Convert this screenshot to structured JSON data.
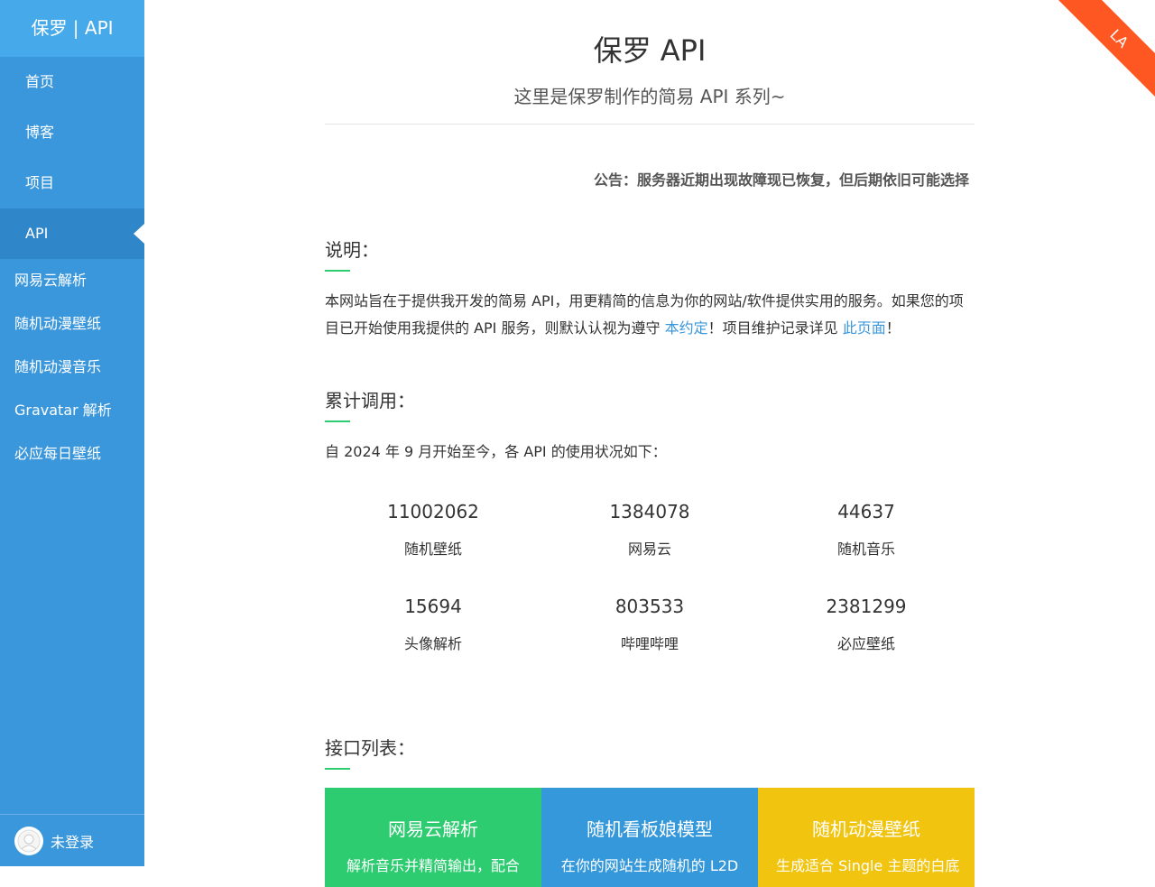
{
  "brand": "保罗 | API",
  "nav": {
    "items": [
      {
        "label": "首页"
      },
      {
        "label": "博客"
      },
      {
        "label": "项目"
      },
      {
        "label": "API"
      }
    ],
    "sub_items": [
      {
        "label": "网易云解析"
      },
      {
        "label": "随机动漫壁纸"
      },
      {
        "label": "随机动漫音乐"
      },
      {
        "label": "Gravatar 解析"
      },
      {
        "label": "必应每日壁纸"
      }
    ]
  },
  "user": {
    "status": "未登录"
  },
  "ribbon": {
    "text": "LA"
  },
  "header": {
    "title": "保罗 API",
    "subtitle": "这里是保罗制作的简易 API 系列~"
  },
  "notice": "公告：服务器近期出现故障现已恢复，但后期依旧可能选择",
  "description": {
    "title": "说明：",
    "text_part1": "本网站旨在于提供我开发的简易 API，用更精简的信息为你的网站/软件提供实用的服务。如果您的项目已开始使用我提供的 API 服务，则默认认视为遵守 ",
    "link1": "本约定",
    "text_part2": "！项目维护记录详见 ",
    "link2": "此页面",
    "text_part3": "！"
  },
  "usage": {
    "title": "累计调用：",
    "intro": "自 2024 年 9 月开始至今，各 API 的使用状况如下：",
    "stats": [
      {
        "value": "11002062",
        "label": "随机壁纸"
      },
      {
        "value": "1384078",
        "label": "网易云"
      },
      {
        "value": "44637",
        "label": "随机音乐"
      },
      {
        "value": "15694",
        "label": "头像解析"
      },
      {
        "value": "803533",
        "label": "哔哩哔哩"
      },
      {
        "value": "2381299",
        "label": "必应壁纸"
      }
    ]
  },
  "api_list": {
    "title": "接口列表：",
    "cards": [
      {
        "title": "网易云解析",
        "desc": "解析音乐并精简输出，配合",
        "color": "#2ecc71"
      },
      {
        "title": "随机看板娘模型",
        "desc": "在你的网站生成随机的 L2D",
        "color": "#3498db"
      },
      {
        "title": "随机动漫壁纸",
        "desc": "生成适合 Single 主题的白底",
        "color": "#f1c40f"
      }
    ]
  },
  "colors": {
    "sidebar": "#3b97dc",
    "brand_bg": "#45a9ea",
    "active_item": "#2f86c9",
    "accent_green": "#2ecc71",
    "link": "#3b97dc",
    "ribbon": "#ff5722"
  }
}
